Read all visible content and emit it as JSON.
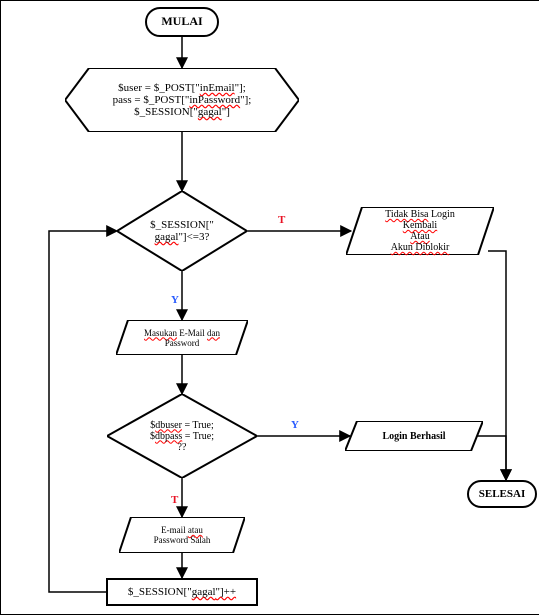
{
  "terminator": {
    "start": "MULAI",
    "end": "SELESAI"
  },
  "process": {
    "init_line1a": "$user = $_POST[\"",
    "init_line1b": "inEmail",
    "init_line1c": "\"];",
    "init_line2a": "pass = $_POST[\"",
    "init_line2b": "inPassword",
    "init_line2c": "\"];",
    "init_line3a": "$_SESSION[\"",
    "init_line3b": "gagal",
    "init_line3c": "\"]",
    "counter_a": "$_SESSION[\"",
    "counter_b": "gagal",
    "counter_c": "\"]++"
  },
  "decision": {
    "d1_a": "$_SESSION[\"",
    "d1_b": "gagal",
    "d1_c": "\"]<=3?",
    "d2_a": "$",
    "d2_b": "dbuser",
    "d2_c": " = True;",
    "d2_d": "$",
    "d2_e": "dbpass",
    "d2_f": " = True;",
    "d2_g": "??"
  },
  "io": {
    "input_a": "Masukan",
    "input_b": " E-Mail ",
    "input_c": "dan",
    "input_d": "Password",
    "fail_a": "E-mail ",
    "fail_b": "atau",
    "fail_c": "Password Salah",
    "blocked_a": "Tidak Bisa",
    "blocked_b": " Login",
    "blocked_c": "Kembali",
    "blocked_d": "Atau",
    "blocked_e": "Akun Diblokir",
    "success": "Login Berhasil"
  },
  "labels": {
    "T": "T",
    "Y": "Y"
  },
  "chart_data": {
    "type": "flowchart",
    "nodes": [
      {
        "id": "start",
        "kind": "terminator",
        "text": "MULAI"
      },
      {
        "id": "init",
        "kind": "preparation",
        "text": "$user = $_POST[\"inEmail\"]; pass = $_POST[\"inPassword\"]; $_SESSION[\"gagal\"]"
      },
      {
        "id": "d1",
        "kind": "decision",
        "text": "$_SESSION[\"gagal\"]<=3?"
      },
      {
        "id": "blocked",
        "kind": "io",
        "text": "Tidak Bisa Login Kembali Atau Akun Diblokir"
      },
      {
        "id": "input",
        "kind": "io",
        "text": "Masukan E-Mail dan Password"
      },
      {
        "id": "d2",
        "kind": "decision",
        "text": "$dbuser = True; $dbpass = True; ??"
      },
      {
        "id": "success",
        "kind": "io",
        "text": "Login Berhasil"
      },
      {
        "id": "fail",
        "kind": "io",
        "text": "E-mail atau Password Salah"
      },
      {
        "id": "counter",
        "kind": "process",
        "text": "$_SESSION[\"gagal\"]++"
      },
      {
        "id": "end",
        "kind": "terminator",
        "text": "SELESAI"
      }
    ],
    "edges": [
      {
        "from": "start",
        "to": "init"
      },
      {
        "from": "init",
        "to": "d1"
      },
      {
        "from": "d1",
        "to": "blocked",
        "label": "T"
      },
      {
        "from": "d1",
        "to": "input",
        "label": "Y"
      },
      {
        "from": "input",
        "to": "d2"
      },
      {
        "from": "d2",
        "to": "success",
        "label": "Y"
      },
      {
        "from": "d2",
        "to": "fail",
        "label": "T"
      },
      {
        "from": "fail",
        "to": "counter"
      },
      {
        "from": "counter",
        "to": "d1"
      },
      {
        "from": "blocked",
        "to": "end"
      },
      {
        "from": "success",
        "to": "end"
      }
    ]
  }
}
